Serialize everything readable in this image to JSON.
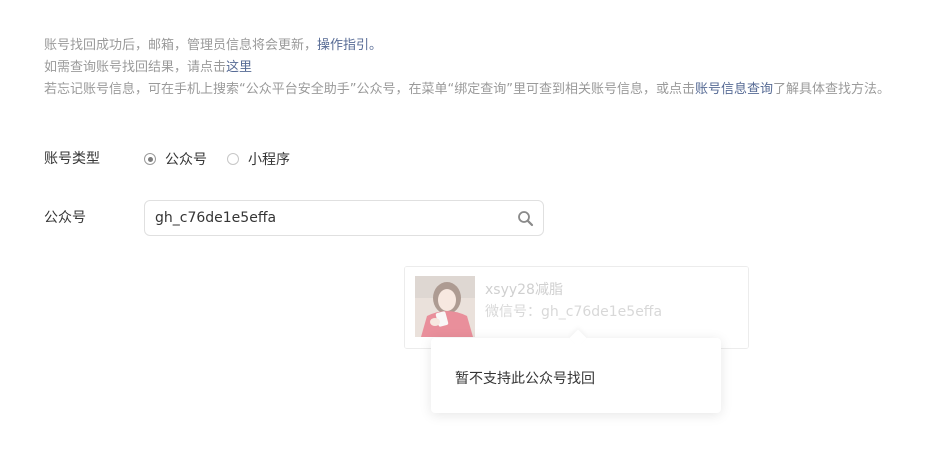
{
  "notice": {
    "line1_text": "账号找回成功后，邮箱，管理员信息将会更新，",
    "line1_link": "操作指引。",
    "line2_text": "如需查询账号找回结果，请点击",
    "line2_link": "这里",
    "line3_text": "若忘记账号信息，可在手机上搜索“公众平台安全助手”公众号，在菜单“绑定查询”里可查到相关账号信息，或点击",
    "line3_link": "账号信息查询",
    "line3_suffix": "了解具体查找方法。"
  },
  "form": {
    "type_label": "账号类型",
    "options": [
      {
        "label": "公众号",
        "checked": true
      },
      {
        "label": "小程序",
        "checked": false
      }
    ],
    "account_label": "公众号",
    "search_value": "gh_c76de1e5effa"
  },
  "result": {
    "name": "xsyy28减脂",
    "wechat_id": "微信号：gh_c76de1e5effa"
  },
  "tooltip": {
    "message": "暂不支持此公众号找回"
  },
  "colors": {
    "link": "#576b95",
    "muted_text": "#9a9a9a"
  }
}
